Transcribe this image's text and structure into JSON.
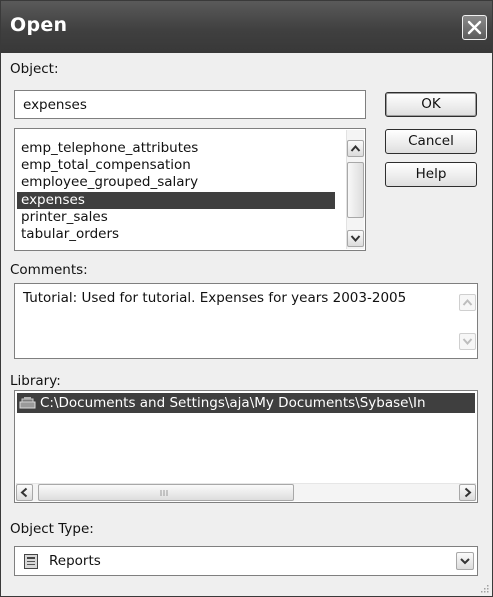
{
  "window": {
    "title": "Open"
  },
  "object": {
    "label": "Object:",
    "value": "expenses",
    "list": [
      "emp_telephone_attributes",
      "emp_total_compensation",
      "employee_grouped_salary",
      "expenses",
      "printer_sales",
      "tabular_orders"
    ],
    "selected": "expenses"
  },
  "buttons": {
    "ok": "OK",
    "cancel": "Cancel",
    "help": "Help"
  },
  "comments": {
    "label": "Comments:",
    "text": "Tutorial: Used for tutorial. Expenses for years 2003-2005"
  },
  "library": {
    "label": "Library:",
    "path": "C:\\Documents and Settings\\aja\\My Documents\\Sybase\\In"
  },
  "object_type": {
    "label": "Object Type:",
    "value": "Reports"
  },
  "icons": {
    "close": "close-icon",
    "up": "arrow-up-icon",
    "down": "arrow-down-icon",
    "left": "arrow-left-icon",
    "right": "arrow-right-icon",
    "library": "library-icon",
    "report": "report-icon",
    "grip": "resize-grip-icon"
  },
  "colors": {
    "selection": "#3f3f3f",
    "titlebar": "#404040",
    "window": "#efefef"
  }
}
